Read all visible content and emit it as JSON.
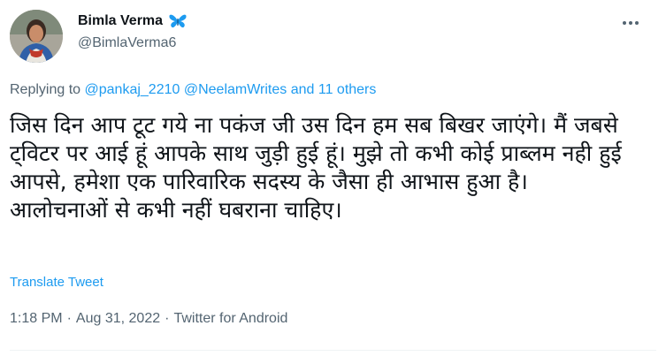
{
  "author": {
    "name": "Bimla Verma",
    "handle": "@BimlaVerma6",
    "badge_icon": "butterfly-icon",
    "badge_color": "#1d9bf0"
  },
  "reply": {
    "prefix": "Replying to ",
    "mentions": [
      "@pankaj_2210",
      "@NeelamWrites"
    ],
    "others": "and 11 others"
  },
  "tweet": {
    "text": "जिस दिन आप टूट गये ना पकंज जी उस दिन हम सब बिखर जाएंगे। मैं  जबसे ट्विटर पर आई हूं आपके साथ जुड़ी हुई हूं। मुझे तो कभी कोई प्राब्लम नही हुई आपसे, हमेशा एक पारिवारिक सदस्य के जैसा ही आभास हुआ है। आलोचनाओं से कभी नहीं घबराना चाहिए।",
    "translate_label": "Translate Tweet"
  },
  "meta": {
    "time": "1:18 PM",
    "date": "Aug 31, 2022",
    "source": "Twitter for Android",
    "separator": "·"
  },
  "colors": {
    "link": "#1d9bf0",
    "secondary_text": "#536471",
    "primary_text": "#0f1419"
  }
}
